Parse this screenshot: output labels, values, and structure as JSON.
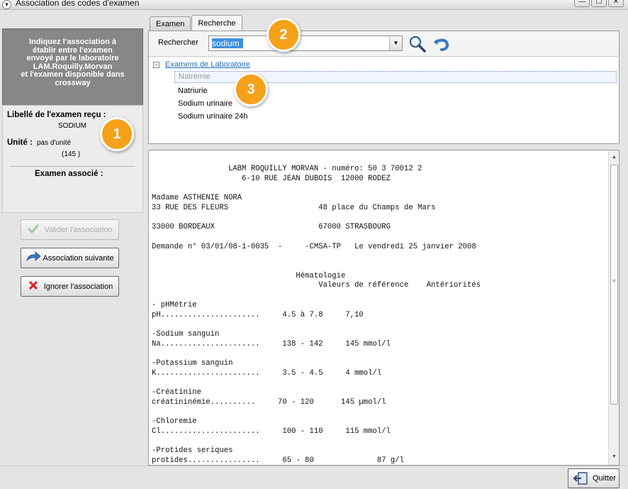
{
  "window": {
    "title": "Association des codes d'examen",
    "buttons": [
      "—",
      "☐",
      "✕"
    ]
  },
  "left": {
    "instruction_lines": [
      "Indiquez l'association à",
      "établir entre l'examen",
      "envoyé par le laboratoire",
      "LAM.Roquilly.Morvan",
      "et l'examen disponible dans",
      "crossway"
    ],
    "received_label": "Libellé de l'examen reçu :",
    "received_value": "SODIUM",
    "unit_label": "Unité :",
    "unit_value": "pas d'unité",
    "count_value": "(145 )",
    "associated_label": "Examen associé :",
    "buttons": {
      "validate": "Valider l'association",
      "next": "Association suivante",
      "ignore": "Ignorer l'association"
    }
  },
  "tabs": [
    "Examen",
    "Recherche"
  ],
  "search": {
    "label": "Rechercher",
    "value": "sodium"
  },
  "tree": {
    "root": "Examens de Laboratoire",
    "items": [
      "Natrémie",
      "Natriurie",
      "Sodium urinaire",
      "Sodium urinaire 24h"
    ],
    "selected_index": 0
  },
  "report": {
    "lines": [
      "                 LABM ROQUILLY MORVAN - numéro: 50 3 70012 2",
      "                    6-10 RUE JEAN DUBOIS  12000 RODEZ",
      "",
      "Madame ASTHENIE NORA",
      "33 RUE DES FLEURS                    48 place du Champs de Mars",
      "",
      "33000 BORDEAUX                       67000 STRASBOURG",
      "",
      "Demande n° 03/01/08-1-0035  -     -CMSA-TP   Le vendredi 25 janvier 2008",
      "",
      "",
      "                                Hématologie",
      "                                     Valeurs de référence    Antériorités",
      "",
      "- pHMétrie",
      "pH......................     4.5 à 7.8     7,10",
      "",
      "-Sodium sanguin",
      "Na......................     138 - 142     145 mmol/l",
      "",
      "-Potassium sanguin",
      "K.......................     3.5 - 4.5     4 mmol/l",
      "",
      "-Créatinine",
      "créatininémie..........     70 - 120      145 µmol/l",
      "",
      "-Chloremie",
      "Cl......................     100 - 110     115 mmol/l",
      "",
      "-Protides seriques",
      "protides................     65 - 80              87 g/l"
    ]
  },
  "footer": {
    "quit_label": "Quitter"
  },
  "badges": [
    "1",
    "2",
    "3"
  ],
  "colors": {
    "instruction_bg": "#878787",
    "badge": "#f5a11a",
    "link": "#1e6fbf",
    "selection": "#3e8fe0"
  }
}
